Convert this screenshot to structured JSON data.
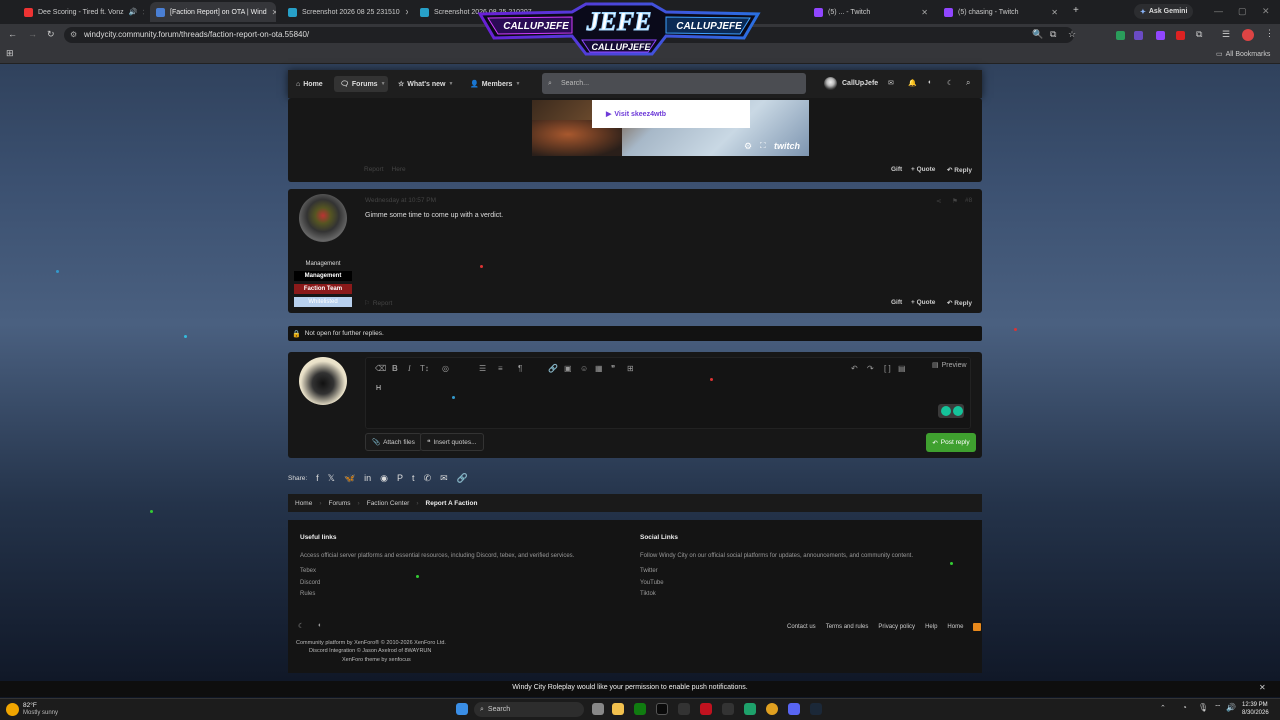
{
  "tabs": [
    {
      "title": "Dee Scoring - Tired ft. Vonz",
      "color": "#e33"
    },
    {
      "title": "[Faction Report] on OTA | Wind",
      "color": "#4a7fd4"
    },
    {
      "title": "Screenshot 2026 08 25 231510",
      "color": "#27a0c8"
    },
    {
      "title": "Screenshot 2026 08 25 210207",
      "color": "#27a0c8"
    },
    {
      "title": "(5) ... - Twitch",
      "color": "#9146ff"
    },
    {
      "title": "(5) chasing - Twitch",
      "color": "#9146ff"
    }
  ],
  "banner": {
    "title": "JEFE",
    "handle1": "CALLUPJEFE",
    "handle2": "CALLUPJEFE",
    "handle3": "CALLUPJEFE"
  },
  "browser": {
    "url": "windycity.community.forum/threads/faction-report-on-ota.55840/",
    "ask_gemini": "Ask Gemini",
    "all_bookmarks": "All Bookmarks"
  },
  "nav": {
    "home": "Home",
    "forums": "Forums",
    "whats_new": "What's new",
    "members": "Members",
    "search_placeholder": "Search...",
    "username": "CallUpJefe"
  },
  "post1": {
    "twitch_link": "Visit skeez4wtb",
    "twitch_brand": "twitch",
    "report": "Report",
    "share": "Here",
    "gift": "Gift",
    "quote": "Quote",
    "reply": "Reply"
  },
  "post2": {
    "timestamp": "Wednesday at 10:57 PM",
    "share_count": "#8",
    "text": "Gimme some time to come up with a verdict.",
    "roles": [
      "Management",
      "Management",
      "Faction Team",
      "Whitelisted"
    ],
    "report": "Report",
    "gift": "Gift",
    "quote": "Quote",
    "reply": "Reply"
  },
  "notice": "Not open for further replies.",
  "editor": {
    "content": "H",
    "preview": "Preview",
    "attach": "Attach files",
    "insert_quotes": "Insert quotes...",
    "post_reply": "Post reply"
  },
  "share_label": "Share:",
  "breadcrumbs": [
    "Home",
    "Forums",
    "Faction Center",
    "Report A Faction"
  ],
  "footer": {
    "useful_title": "Useful links",
    "useful_desc": "Access official server platforms and essential resources, including Discord, tebex, and verified services.",
    "useful_links": [
      "Tebex",
      "Discord",
      "Rules"
    ],
    "social_title": "Social Links",
    "social_desc": "Follow Windy City on our official social platforms for updates, announcements, and community content.",
    "social_links": [
      "Twitter",
      "YouTube",
      "Tiktok"
    ],
    "bottom_links": [
      "Contact us",
      "Terms and rules",
      "Privacy policy",
      "Help",
      "Home"
    ],
    "credit1": "Community platform by XenForo® © 2010-2026 XenForo Ltd.",
    "credit2": "Discord Integration © Jason Axelrod of 8WAYRUN",
    "credit3": "XenForo theme by xenfocus"
  },
  "push_notice": "Windy City Roleplay would like your permission to enable push notifications.",
  "taskbar": {
    "temp": "82°F",
    "weather": "Mostly sunny",
    "search": "Search",
    "time": "12:39 PM",
    "date": "8/30/2026"
  }
}
